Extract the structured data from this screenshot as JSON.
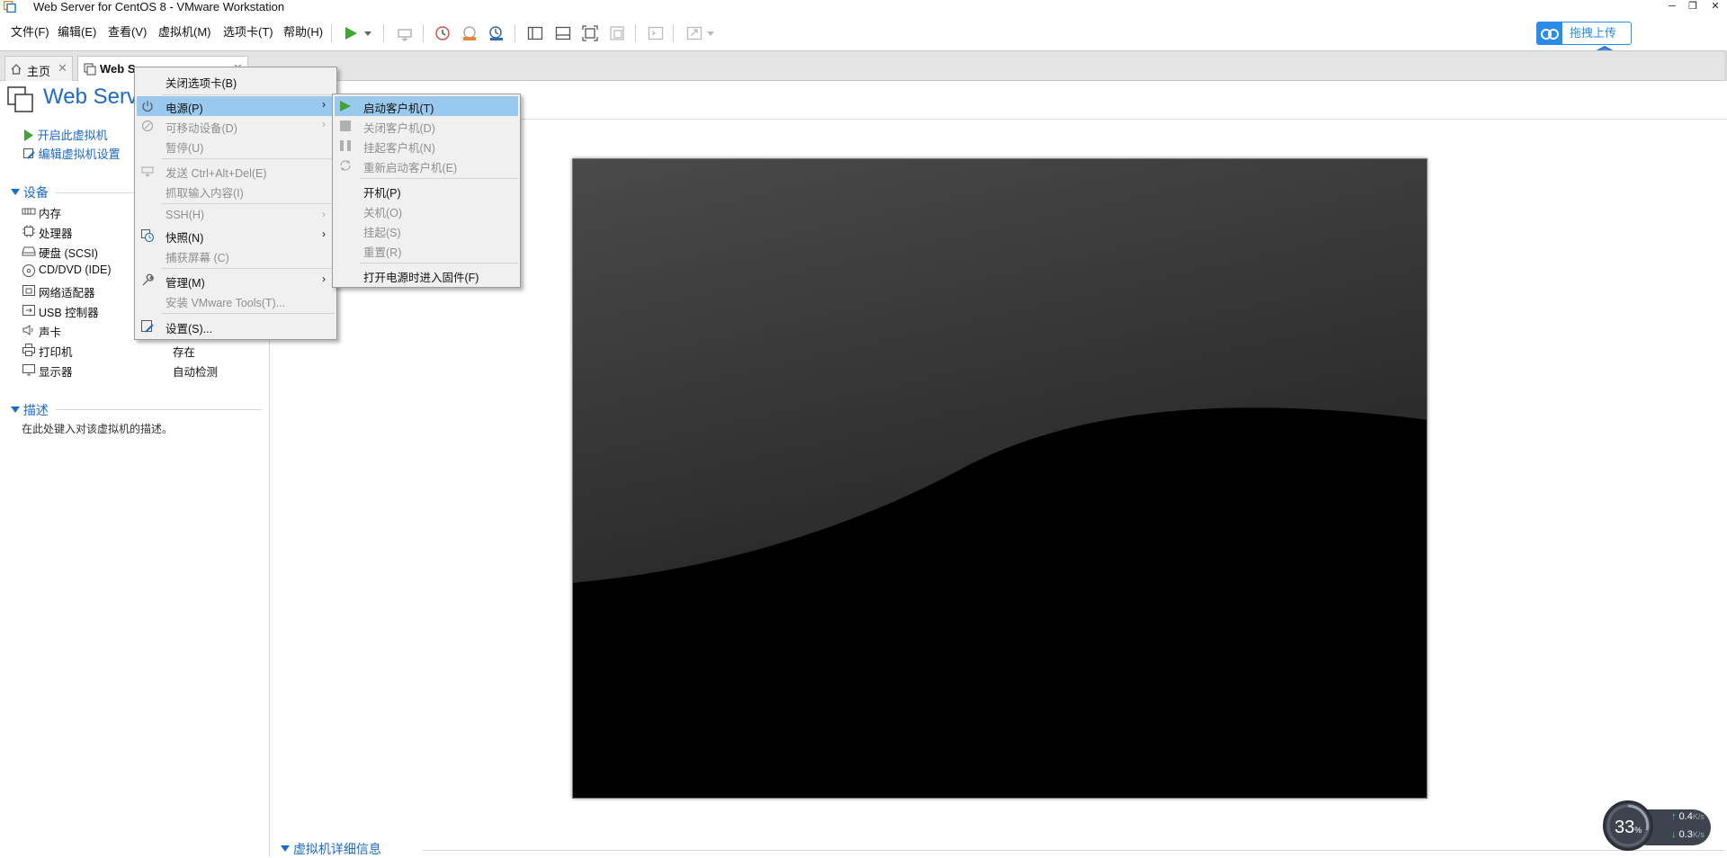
{
  "window": {
    "title": "Web Server for CentOS 8 - VMware Workstation",
    "minimize": "─",
    "maximize": "❐",
    "close": "✕"
  },
  "menubar": [
    "文件(F)",
    "编辑(E)",
    "查看(V)",
    "虚拟机(M)",
    "选项卡(T)",
    "帮助(H)"
  ],
  "baidu_upload_label": "拖拽上传",
  "tabs": [
    {
      "label": "主页",
      "close": "✕"
    },
    {
      "label": "Web Se",
      "close": "✕"
    }
  ],
  "vm": {
    "title": "Web Serve",
    "actions": [
      "开启此虚拟机",
      "编辑虚拟机设置"
    ]
  },
  "devices_section": "设备",
  "devices": [
    {
      "name": "内存",
      "value": ""
    },
    {
      "name": "处理器",
      "value": ""
    },
    {
      "name": "硬盘 (SCSI)",
      "value": ""
    },
    {
      "name": "CD/DVD (IDE)",
      "value": ""
    },
    {
      "name": "网络适配器",
      "value": ""
    },
    {
      "name": "USB 控制器",
      "value": ""
    },
    {
      "name": "声卡",
      "value": ""
    },
    {
      "name": "打印机",
      "value": "存在"
    },
    {
      "name": "显示器",
      "value": "自动检测"
    }
  ],
  "description_section": "描述",
  "description_placeholder": "在此处键入对该虚拟机的描述。",
  "details_section": "虚拟机详细信息",
  "speed_widget": {
    "percent": "33",
    "percent_unit": "%",
    "up": "0.4",
    "down": "0.3",
    "unit": "K/s",
    "up_arrow": "↑",
    "down_arrow": "↓"
  },
  "context_menu": {
    "items": [
      {
        "label": "关闭选项卡(B)",
        "disabled": false
      },
      {
        "label": "电源(P)",
        "disabled": false,
        "submenu": true,
        "highlighted": true,
        "icon": "power-icon"
      },
      {
        "label": "可移动设备(D)",
        "disabled": true,
        "submenu": true,
        "icon": "removable-device-icon"
      },
      {
        "label": "暂停(U)",
        "disabled": true
      },
      {
        "label": "发送 Ctrl+Alt+Del(E)",
        "disabled": true,
        "icon": "keyboard-icon"
      },
      {
        "label": "抓取输入内容(I)",
        "disabled": true
      },
      {
        "label": "SSH(H)",
        "disabled": true,
        "submenu": true
      },
      {
        "label": "快照(N)",
        "disabled": false,
        "submenu": true,
        "icon": "snapshot-icon"
      },
      {
        "label": "捕获屏幕 (C)",
        "disabled": true
      },
      {
        "label": "管理(M)",
        "disabled": false,
        "submenu": true,
        "icon": "wrench-icon"
      },
      {
        "label": "安装 VMware Tools(T)...",
        "disabled": true
      },
      {
        "label": "设置(S)...",
        "disabled": false,
        "icon": "settings-icon"
      }
    ],
    "submenu_arrow": "›"
  },
  "power_submenu": {
    "items": [
      {
        "label": "启动客户机(T)",
        "disabled": false,
        "highlighted": true,
        "icon": "play-icon"
      },
      {
        "label": "关闭客户机(D)",
        "disabled": true,
        "icon": "stop-icon"
      },
      {
        "label": "挂起客户机(N)",
        "disabled": true,
        "icon": "pause-icon"
      },
      {
        "label": "重新启动客户机(E)",
        "disabled": true,
        "icon": "restart-icon"
      },
      {
        "label": "开机(P)",
        "disabled": false
      },
      {
        "label": "关机(O)",
        "disabled": true
      },
      {
        "label": "挂起(S)",
        "disabled": true
      },
      {
        "label": "重置(R)",
        "disabled": true
      },
      {
        "label": "打开电源时进入固件(F)",
        "disabled": false
      }
    ]
  },
  "colors": {
    "link_blue": "#1b6ac9",
    "menu_highlight": "#99c9ef",
    "play_green": "#3fa535",
    "baidu_blue": "#2a8be8"
  }
}
